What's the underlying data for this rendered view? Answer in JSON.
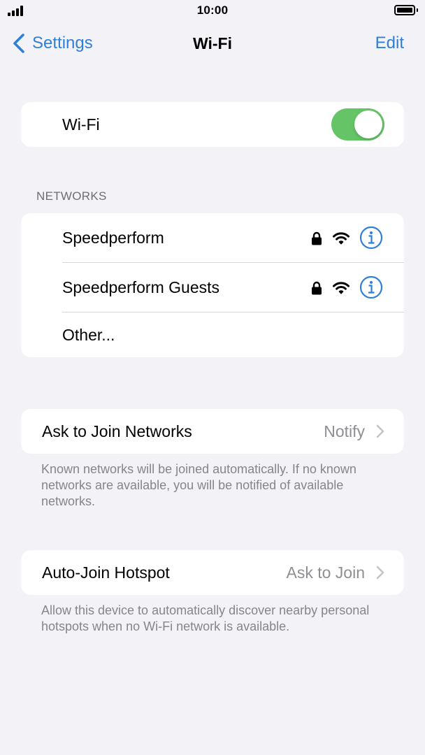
{
  "status_bar": {
    "time": "10:00"
  },
  "nav": {
    "back_label": "Settings",
    "title": "Wi-Fi",
    "edit_label": "Edit"
  },
  "wifi_toggle": {
    "label": "Wi-Fi",
    "on": true
  },
  "networks": {
    "header": "NETWORKS",
    "items": [
      {
        "name": "Speedperform",
        "secured": true,
        "icons": [
          "lock-icon",
          "wifi-icon",
          "info-icon"
        ]
      },
      {
        "name": "Speedperform Guests",
        "secured": true,
        "icons": [
          "lock-icon",
          "wifi-icon",
          "info-icon"
        ]
      }
    ],
    "other_label": "Other..."
  },
  "ask_to_join": {
    "label": "Ask to Join Networks",
    "value": "Notify",
    "footer": "Known networks will be joined automatically. If no known networks are available, you will be notified of available networks."
  },
  "auto_join_hotspot": {
    "label": "Auto-Join Hotspot",
    "value": "Ask to Join",
    "footer": "Allow this device to automatically discover nearby personal hotspots when no Wi-Fi network is available."
  },
  "colors": {
    "accent": "#2F7FD8",
    "toggle_on": "#65C466",
    "background": "#F2F2F7",
    "secondary_text": "#8E8E93"
  }
}
